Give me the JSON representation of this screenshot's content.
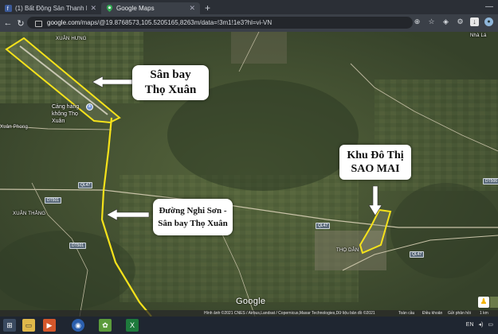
{
  "browser": {
    "tabs": [
      {
        "title": "(1) Bất Động Sản Thanh Hóa",
        "active": false
      },
      {
        "title": "Google Maps",
        "active": true
      }
    ],
    "new_tab": "+",
    "url_host": "google.com",
    "url_path": "/maps/@19.8768573,105.5205165,8263m/data=!3m1!1e3?hl=vi-VN"
  },
  "map": {
    "places": {
      "xuan_hung": "XUÂN HƯNG",
      "xuan_thang": "XUÂN THẮNG",
      "tho_dan": "THỌ DÂN",
      "nha_la": "Nhà Lá",
      "xuan_phong": "Xuân Phong"
    },
    "airport_name": "Cảng hàng không Thọ Xuân",
    "roads": {
      "ql47_a": "QL47",
      "ql47_b": "QL47",
      "ql47_c": "QL47",
      "dt501_a": "DT501",
      "dt501_b": "DT501",
      "dt506": "DT506"
    },
    "callouts": {
      "airport": [
        "Sân bay",
        "Thọ Xuân"
      ],
      "urban": [
        "Khu Đô Thị",
        "SAO MAI"
      ],
      "road": [
        "Đường Nghi Sơn -",
        "Sân bay Thọ Xuân"
      ]
    },
    "google_logo": "Google",
    "attribution": {
      "imagery": "Hình ảnh ©2021 CNES / Airbus,Landsat / Copernicus,Maxar Technologies,Dữ liệu bản đồ ©2021",
      "terms": "Toàn cầu",
      "terms2": "Điều khoản",
      "report": "Gửi phản hồi",
      "scale": "1 km"
    },
    "colors": {
      "highlight": "#f5e21b",
      "arrow": "#ffffff"
    }
  },
  "taskbar": {
    "tray_lang": "EN"
  }
}
